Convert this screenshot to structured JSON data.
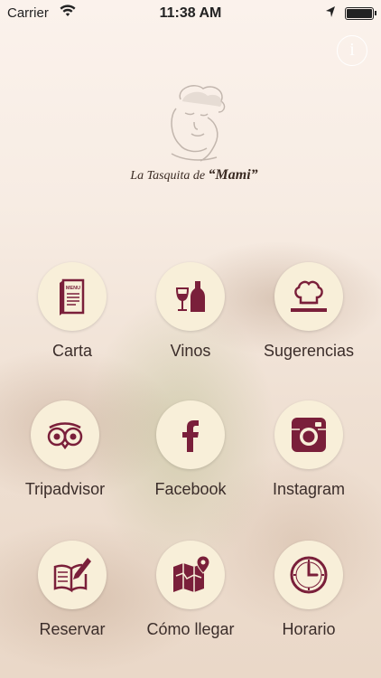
{
  "status_bar": {
    "carrier": "Carrier",
    "time": "11:38 AM"
  },
  "header": {
    "info_label": "i",
    "logo_text": "La Tasquita de",
    "logo_name": "“Mami”"
  },
  "colors": {
    "accent": "#7a1f3a",
    "circle_bg": "#f8efd9",
    "label": "#3b2d2a"
  },
  "menu": [
    {
      "label": "Carta",
      "icon": "menu-icon"
    },
    {
      "label": "Vinos",
      "icon": "wine-icon"
    },
    {
      "label": "Sugerencias",
      "icon": "chef-hat-icon"
    },
    {
      "label": "Tripadvisor",
      "icon": "tripadvisor-icon"
    },
    {
      "label": "Facebook",
      "icon": "facebook-icon"
    },
    {
      "label": "Instagram",
      "icon": "instagram-icon"
    },
    {
      "label": "Reservar",
      "icon": "book-pen-icon"
    },
    {
      "label": "Cómo llegar",
      "icon": "map-pin-icon"
    },
    {
      "label": "Horario",
      "icon": "clock-icon"
    }
  ]
}
